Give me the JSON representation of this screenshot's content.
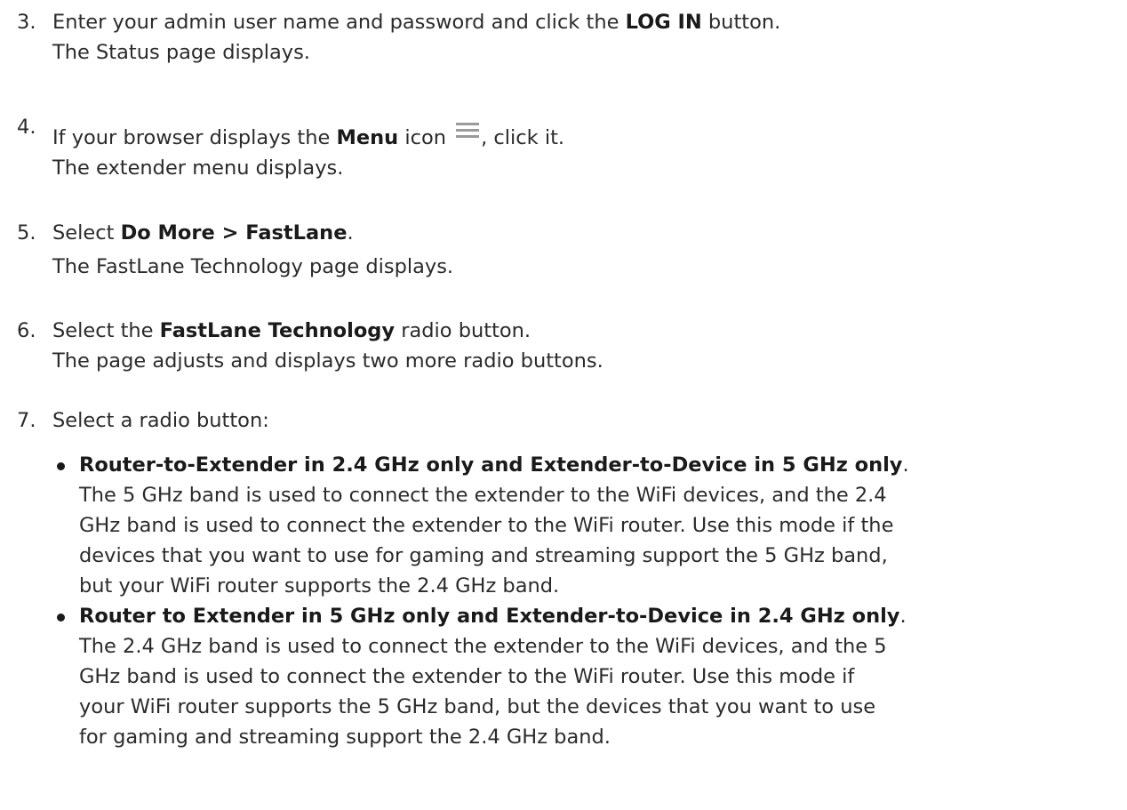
{
  "steps": [
    {
      "number": "3.",
      "text_pre": "Enter your admin user name and password and click the ",
      "bold": "LOG IN",
      "text_post": " button.",
      "result": "The Status page displays."
    },
    {
      "number": "4.",
      "text_pre": "If your browser displays the ",
      "bold": "Menu",
      "text_mid": " icon ",
      "icon": "hamburger-menu-icon",
      "text_post": ", click it.",
      "result": "The extender menu displays."
    },
    {
      "number": "5.",
      "text_pre": "Select ",
      "bold": "Do More > FastLane",
      "text_post": ".",
      "result": "The FastLane Technology page displays."
    },
    {
      "number": "6.",
      "text_pre": "Select the ",
      "bold": "FastLane Technology",
      "text_post": " radio button.",
      "result": "The page adjusts and displays two more radio buttons."
    },
    {
      "number": "7.",
      "text": "Select a radio button:",
      "options": [
        {
          "title": "Router-to-Extender in 2.4 GHz only and Extender-to-Device in 5 GHz only",
          "title_end": ".",
          "lines": [
            "The 5 GHz band is used to connect the extender to the WiFi devices, and the 2.4",
            "GHz band is used to connect the extender to the WiFi router. Use this mode if the",
            "devices that you want to use for gaming and streaming support the 5 GHz band,",
            "but your WiFi router supports the 2.4 GHz band."
          ]
        },
        {
          "title": "Router to Extender in 5 GHz only and Extender-to-Device in 2.4 GHz only",
          "title_end": ".",
          "lines": [
            "The 2.4 GHz band is used to connect the extender to the WiFi devices, and the 5",
            "GHz band is used to connect the extender to the WiFi router. Use this mode if",
            "your WiFi router supports the 5 GHz band, but the devices that you want to use",
            "for gaming and streaming support the 2.4 GHz band."
          ]
        }
      ]
    }
  ]
}
